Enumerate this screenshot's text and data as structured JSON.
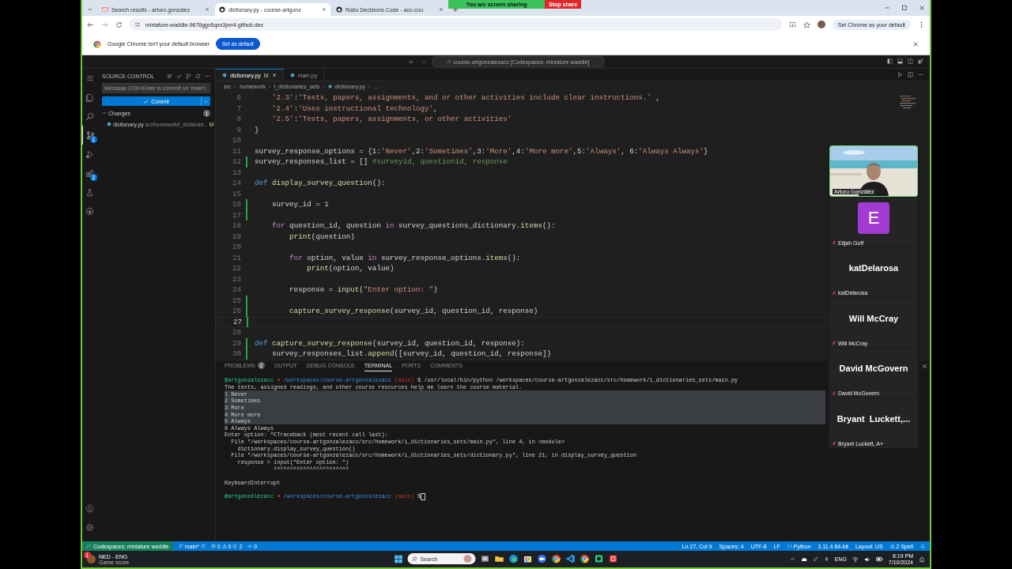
{
  "browser": {
    "tabs": [
      {
        "kind": "mail",
        "title": "Search results - arturo.gonzalez",
        "selected": false
      },
      {
        "kind": "github",
        "title": "dictionary.py - course-artgonz",
        "selected": true
      },
      {
        "kind": "github",
        "title": "Ratio Decisions Code - acc-cou",
        "selected": false
      }
    ],
    "sharing": {
      "label": "You are screen sharing",
      "stop": "Stop share"
    },
    "url": "miniature-waddle-9676ggv6qxx3pvr4.github.dev",
    "default_button": "Set Chrome as your default",
    "infobar": {
      "message": "Google Chrome isn't your default browser",
      "button": "Set as default"
    }
  },
  "vscode": {
    "title": "course-artgonzalezacc [Codespaces: miniature waddle]",
    "activity": [
      {
        "kind": "explorer",
        "selected": false
      },
      {
        "kind": "search",
        "selected": false
      },
      {
        "kind": "scm",
        "selected": true,
        "badge": "1"
      },
      {
        "kind": "run",
        "selected": false
      },
      {
        "kind": "extensions",
        "selected": false,
        "badge": "2"
      },
      {
        "kind": "testing",
        "selected": false
      },
      {
        "kind": "github",
        "selected": false
      }
    ],
    "sidebar": {
      "title": "SOURCE CONTROL",
      "message_placeholder": "Message (Ctrl+Enter to commit on 'main')",
      "commit": "Commit",
      "changes": {
        "label": "Changes",
        "count": "1",
        "expanded": true,
        "files": [
          {
            "name": "dictionary.py",
            "path": "src/homework/i_dictionari...",
            "status": "M"
          }
        ]
      }
    },
    "tabs": [
      {
        "name": "dictionary.py",
        "status": "M",
        "selected": true
      },
      {
        "name": "main.py",
        "selected": false
      }
    ],
    "breadcrumbs": [
      "src",
      "homework",
      "i_dictionaries_sets",
      "dictionary.py",
      "..."
    ],
    "code": [
      {
        "n": "6",
        "changed": false,
        "current": false,
        "tokens": [
          {
            "kind": "str",
            "text": "    '2.3'"
          },
          {
            "kind": "plain",
            "text": ":"
          },
          {
            "kind": "str",
            "text": "'Tests, papers, assignments, and or other activities include clear instructions.'"
          },
          {
            "kind": "plain",
            "text": " ,"
          }
        ]
      },
      {
        "n": "7",
        "changed": false,
        "current": false,
        "tokens": [
          {
            "kind": "str",
            "text": "    '2.4'"
          },
          {
            "kind": "plain",
            "text": ":"
          },
          {
            "kind": "str",
            "text": "'Uses instructional technology'"
          },
          {
            "kind": "plain",
            "text": ","
          }
        ]
      },
      {
        "n": "8",
        "changed": false,
        "current": false,
        "tokens": [
          {
            "kind": "str",
            "text": "    '2.5'"
          },
          {
            "kind": "plain",
            "text": ":"
          },
          {
            "kind": "str",
            "text": "'Tests, papers, assignments, or other activities'"
          }
        ]
      },
      {
        "n": "9",
        "changed": false,
        "current": false,
        "tokens": [
          {
            "kind": "plain",
            "text": "}"
          }
        ]
      },
      {
        "n": "10",
        "changed": false,
        "current": false
      },
      {
        "n": "11",
        "changed": false,
        "current": false,
        "tokens": [
          {
            "kind": "plain",
            "text": "survey_response_options = {1:"
          },
          {
            "kind": "str",
            "text": "'Never'"
          },
          {
            "kind": "plain",
            "text": ",2:"
          },
          {
            "kind": "str",
            "text": "'Sometimes'"
          },
          {
            "kind": "plain",
            "text": ",3:"
          },
          {
            "kind": "str",
            "text": "'More'"
          },
          {
            "kind": "plain",
            "text": ",4:"
          },
          {
            "kind": "str",
            "text": "'More more'"
          },
          {
            "kind": "plain",
            "text": ",5:"
          },
          {
            "kind": "str",
            "text": "'Always'"
          },
          {
            "kind": "plain",
            "text": ", 6:"
          },
          {
            "kind": "str",
            "text": "'Always Always'"
          },
          {
            "kind": "plain",
            "text": "}"
          }
        ]
      },
      {
        "n": "12",
        "changed": true,
        "current": false,
        "tokens": [
          {
            "kind": "plain",
            "text": "survey_responses_list = [] "
          },
          {
            "kind": "comment",
            "text": "#surveyid, questionid, response"
          }
        ]
      },
      {
        "n": "13",
        "changed": false,
        "current": false
      },
      {
        "n": "14",
        "changed": false,
        "current": false,
        "tokens": [
          {
            "kind": "keyword",
            "text": "def "
          },
          {
            "kind": "func",
            "text": "display_survey_question"
          },
          {
            "kind": "plain",
            "text": "():"
          }
        ]
      },
      {
        "n": "15",
        "changed": false,
        "current": false
      },
      {
        "n": "16",
        "changed": true,
        "current": false,
        "tokens": [
          {
            "kind": "plain",
            "text": "    survey_id = "
          },
          {
            "kind": "number",
            "text": "1"
          }
        ]
      },
      {
        "n": "17",
        "changed": true,
        "current": false
      },
      {
        "n": "18",
        "changed": false,
        "current": false,
        "tokens": [
          {
            "kind": "control",
            "text": "    for"
          },
          {
            "kind": "plain",
            "text": " question_id, question "
          },
          {
            "kind": "control",
            "text": "in"
          },
          {
            "kind": "plain",
            "text": " survey_questions_dictionary."
          },
          {
            "kind": "func",
            "text": "items"
          },
          {
            "kind": "plain",
            "text": "():"
          }
        ]
      },
      {
        "n": "19",
        "changed": false,
        "current": false,
        "tokens": [
          {
            "kind": "func",
            "text": "        print"
          },
          {
            "kind": "plain",
            "text": "(question)"
          }
        ]
      },
      {
        "n": "20",
        "changed": false,
        "current": false
      },
      {
        "n": "21",
        "changed": false,
        "current": false,
        "tokens": [
          {
            "kind": "control",
            "text": "        for"
          },
          {
            "kind": "plain",
            "text": " option, value "
          },
          {
            "kind": "control",
            "text": "in"
          },
          {
            "kind": "plain",
            "text": " survey_response_options."
          },
          {
            "kind": "func",
            "text": "items"
          },
          {
            "kind": "plain",
            "text": "():"
          }
        ]
      },
      {
        "n": "22",
        "changed": false,
        "current": false,
        "tokens": [
          {
            "kind": "func",
            "text": "            print"
          },
          {
            "kind": "plain",
            "text": "(option, value)"
          }
        ]
      },
      {
        "n": "23",
        "changed": false,
        "current": false
      },
      {
        "n": "24",
        "changed": false,
        "current": false,
        "tokens": [
          {
            "kind": "plain",
            "text": "        response = "
          },
          {
            "kind": "func",
            "text": "input"
          },
          {
            "kind": "plain",
            "text": "("
          },
          {
            "kind": "str",
            "text": "\"Enter option: \""
          },
          {
            "kind": "plain",
            "text": ")"
          }
        ]
      },
      {
        "n": "25",
        "changed": true,
        "current": false
      },
      {
        "n": "26",
        "changed": true,
        "current": false,
        "tokens": [
          {
            "kind": "func",
            "text": "        capture_survey_response"
          },
          {
            "kind": "plain",
            "text": "(survey_id, question_id, response)"
          }
        ]
      },
      {
        "n": "27",
        "changed": true,
        "current": true
      },
      {
        "n": "28",
        "changed": false,
        "current": false
      },
      {
        "n": "29",
        "changed": true,
        "current": false,
        "tokens": [
          {
            "kind": "keyword",
            "text": "def "
          },
          {
            "kind": "func",
            "text": "capture_survey_response"
          },
          {
            "kind": "plain",
            "text": "(survey_id, question_id, response):"
          }
        ]
      },
      {
        "n": "30",
        "changed": true,
        "current": false,
        "tokens": [
          {
            "kind": "plain",
            "text": "    survey_responses_list."
          },
          {
            "kind": "func",
            "text": "append"
          },
          {
            "kind": "plain",
            "text": "([survey_id, question_id, response])"
          }
        ]
      }
    ],
    "panel_tabs": [
      {
        "label": "PROBLEMS",
        "badge": "2",
        "selected": false
      },
      {
        "label": "OUTPUT",
        "selected": false
      },
      {
        "label": "DEBUG CONSOLE",
        "selected": false
      },
      {
        "label": "TERMINAL",
        "selected": true
      },
      {
        "label": "PORTS",
        "selected": false
      },
      {
        "label": "COMMENTS",
        "selected": false
      }
    ],
    "terminal": [
      {
        "selected": false,
        "segs": [
          {
            "kind": "user",
            "text": "@artgonzalezacc "
          },
          {
            "kind": "arrow",
            "text": "➜ "
          },
          {
            "kind": "path",
            "text": "/workspaces/course-artgonzalezacc "
          },
          {
            "kind": "branch",
            "text": "(main)"
          },
          {
            "kind": "plain",
            "text": " $ /usr/local/bin/python /workspaces/course-artgonzalezacc/src/homework/i_dictionaries_sets/main.py"
          }
        ]
      },
      {
        "selected": false,
        "segs": [
          {
            "kind": "plain",
            "text": "The texts, assigned readings, and other course resources help me learn the course material."
          }
        ]
      },
      {
        "selected": true,
        "segs": [
          {
            "kind": "plain",
            "text": "1 Never"
          }
        ]
      },
      {
        "selected": true,
        "segs": [
          {
            "kind": "plain",
            "text": "2 Sometimes"
          }
        ]
      },
      {
        "selected": true,
        "segs": [
          {
            "kind": "plain",
            "text": "3 More"
          }
        ]
      },
      {
        "selected": true,
        "segs": [
          {
            "kind": "plain",
            "text": "4 More more"
          }
        ]
      },
      {
        "selected": true,
        "segs": [
          {
            "kind": "plain",
            "text": "5 Always"
          }
        ]
      },
      {
        "selected": false,
        "segs": [
          {
            "kind": "plain",
            "text": "6 Always Always"
          }
        ]
      },
      {
        "selected": false,
        "segs": [
          {
            "kind": "plain",
            "text": "Enter option: ^CTraceback (most recent call last):"
          }
        ]
      },
      {
        "selected": false,
        "segs": [
          {
            "kind": "plain",
            "text": "  File \"/workspaces/course-artgonzalezacc/src/homework/i_dictionaries_sets/main.py\", line 4, in <module>"
          }
        ]
      },
      {
        "selected": false,
        "segs": [
          {
            "kind": "plain",
            "text": "    dictionary.display_survey_question()"
          }
        ]
      },
      {
        "selected": false,
        "segs": [
          {
            "kind": "plain",
            "text": "  File \"/workspaces/course-artgonzalezacc/src/homework/i_dictionaries_sets/dictionary.py\", line 21, in display_survey_question"
          }
        ]
      },
      {
        "selected": false,
        "segs": [
          {
            "kind": "plain",
            "text": "    response = input(\"Enter option: \")"
          }
        ]
      },
      {
        "selected": false,
        "segs": [
          {
            "kind": "plain",
            "text": "               ^^^^^^^^^^^^^^^^^^^^^^^"
          }
        ]
      },
      {
        "selected": false
      },
      {
        "selected": false,
        "segs": [
          {
            "kind": "plain",
            "text": "KeyboardInterrupt"
          }
        ]
      },
      {
        "selected": false
      },
      {
        "selected": false,
        "segs": [
          {
            "kind": "user",
            "text": "@artgonzalezacc "
          },
          {
            "kind": "arrow",
            "text": "➜ "
          },
          {
            "kind": "path",
            "text": "/workspaces/course-artgonzalezacc "
          },
          {
            "kind": "branch",
            "text": "(main)"
          },
          {
            "kind": "plain",
            "text": " $"
          }
        ]
      }
    ],
    "status": {
      "remote": "Codespaces: miniature waddle",
      "branch": "main*",
      "errors": "0",
      "warnings": "0",
      "infos": "2",
      "ports": "0",
      "right": [
        {
          "kind": "text",
          "text": "Ln 27, Col 9"
        },
        {
          "kind": "text",
          "text": "Spaces: 4"
        },
        {
          "kind": "text",
          "text": "UTF-8"
        },
        {
          "kind": "text",
          "text": "LF"
        },
        {
          "kind": "braces",
          "text": "Python"
        },
        {
          "kind": "text",
          "text": "3.11.4 64-bit"
        },
        {
          "kind": "text",
          "text": "Layout: US"
        },
        {
          "kind": "warning",
          "text": "2 Spell"
        }
      ]
    }
  },
  "participants": {
    "video": {
      "kind": "picture",
      "name": "Arturo González"
    },
    "tiles": [
      {
        "kind": "avatar",
        "initial": "E",
        "color": "#a13bd1",
        "label": "Elijah Goff",
        "muted": true
      },
      {
        "kind": "name",
        "display": "katDelarosa",
        "label": "katDelarosa",
        "muted": true
      },
      {
        "kind": "name",
        "display": "Will McCray",
        "label": "Will McCray",
        "muted": true
      },
      {
        "kind": "name",
        "display": "David McGovern",
        "label": "David McGovern",
        "muted": true
      },
      {
        "kind": "name",
        "display": "Bryant  Luckett,...",
        "label": "Bryant Luckett, A+",
        "muted": true
      }
    ]
  },
  "taskbar": {
    "widget": {
      "title": "NED - ENG",
      "subtitle": "Game score",
      "badge": "1"
    },
    "search": "Search",
    "apps": [
      {
        "kind": "files"
      },
      {
        "kind": "folder"
      },
      {
        "kind": "edge"
      },
      {
        "kind": "store"
      },
      {
        "kind": "zoom"
      },
      {
        "kind": "chrome"
      },
      {
        "kind": "vscode"
      },
      {
        "kind": "chrome"
      },
      {
        "kind": "green"
      },
      {
        "kind": "red"
      }
    ],
    "lang": "ENG",
    "time": "6:19 PM",
    "date": "7/10/2024"
  }
}
